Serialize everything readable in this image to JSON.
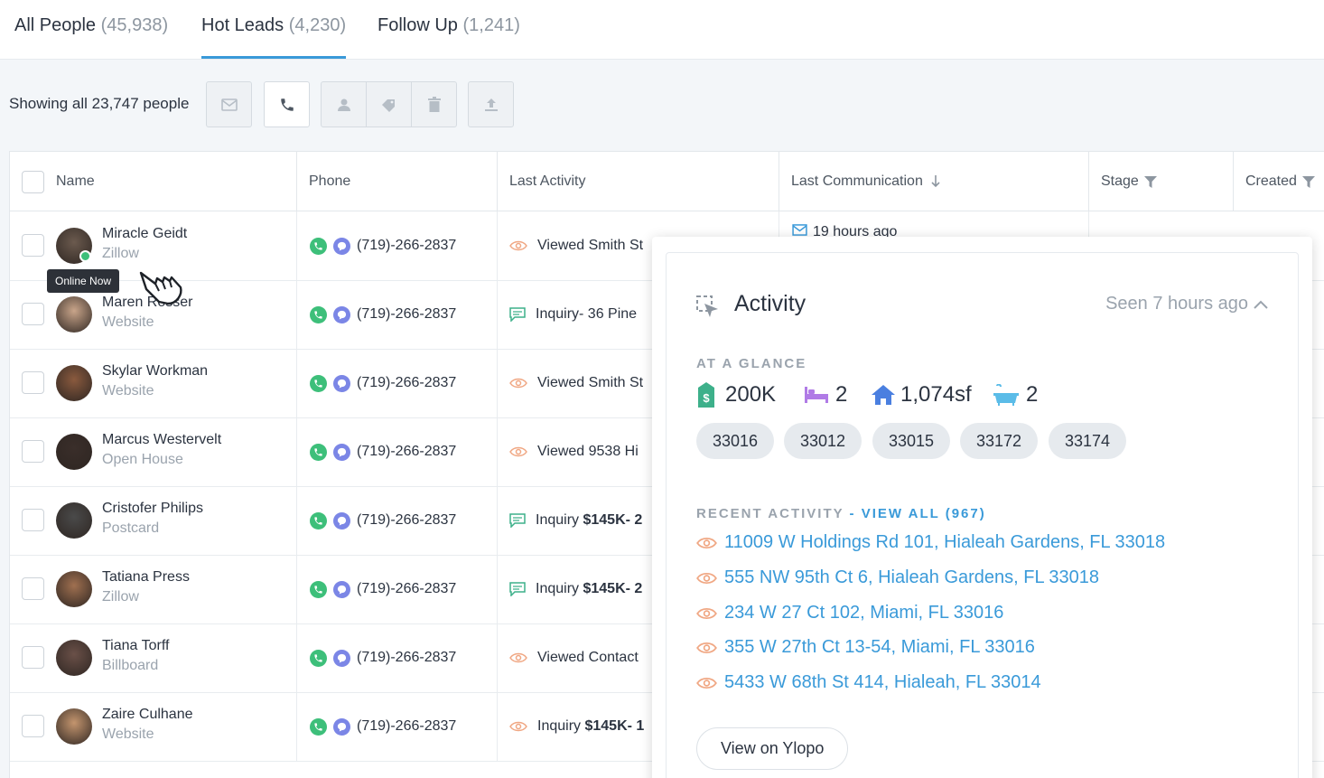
{
  "tabs": [
    {
      "label": "All People",
      "count": "(45,938)"
    },
    {
      "label": "Hot Leads",
      "count": "(4,230)"
    },
    {
      "label": "Follow Up",
      "count": "(1,241)"
    }
  ],
  "toolbar": {
    "showing_label": "Showing all 23,747 people"
  },
  "table": {
    "headers": {
      "name": "Name",
      "phone": "Phone",
      "last_activity": "Last Activity",
      "last_communication": "Last Communication",
      "stage": "Stage",
      "created": "Created"
    },
    "rows": [
      {
        "name": "Miracle Geidt",
        "source": "Zillow",
        "phone": "(719)-266-2837",
        "activity": "Viewed Smith St",
        "activity_icon": "eye-icon",
        "comm": "19 hours ago"
      },
      {
        "name": "Maren Rosser",
        "source": "Website",
        "phone": "(719)-266-2837",
        "activity": "Inquiry- 36 Pine",
        "activity_icon": "chat-icon"
      },
      {
        "name": "Skylar Workman",
        "source": "Website",
        "phone": "(719)-266-2837",
        "activity": "Viewed Smith St",
        "activity_icon": "eye-icon"
      },
      {
        "name": "Marcus Westervelt",
        "source": "Open House",
        "phone": "(719)-266-2837",
        "activity": "Viewed 9538 Hi",
        "activity_icon": "eye-icon"
      },
      {
        "name": "Cristofer Philips",
        "source": "Postcard",
        "phone": "(719)-266-2837",
        "activity_prefix": "Inquiry ",
        "activity_bold": "$145K- 2",
        "activity_icon": "chat-icon"
      },
      {
        "name": "Tatiana Press",
        "source": "Zillow",
        "phone": "(719)-266-2837",
        "activity_prefix": "Inquiry ",
        "activity_bold": "$145K- 2",
        "activity_icon": "chat-icon"
      },
      {
        "name": "Tiana Torff",
        "source": "Billboard",
        "phone": "(719)-266-2837",
        "activity": "Viewed Contact",
        "activity_icon": "eye-icon"
      },
      {
        "name": "Zaire Culhane",
        "source": "Website",
        "phone": "(719)-266-2837",
        "activity_prefix": "Inquiry ",
        "activity_bold": "$145K- 1",
        "activity_icon": "eye-icon"
      }
    ]
  },
  "tooltip": {
    "text": "Online Now"
  },
  "popup": {
    "title": "Activity",
    "seen": "Seen 7 hours ago",
    "glance_label": "AT A GLANCE",
    "glance": {
      "price": "200K",
      "beds": "2",
      "sqft": "1,074sf",
      "baths": "2"
    },
    "zips": [
      "33016",
      "33012",
      "33015",
      "33172",
      "33174"
    ],
    "recent_label": "RECENT ACTIVITY",
    "recent_link": "- VIEW ALL (967)",
    "recent": [
      "11009 W Holdings Rd 101, Hialeah Gardens, FL 33018",
      "555 NW 95th Ct 6, Hialeah Gardens, FL 33018",
      "234 W 27 Ct 102, Miami, FL 33016",
      "355 W 27th Ct 13-54, Miami, FL 33016",
      "5433 W 68th St 414, Hialeah, FL 33014"
    ],
    "view_button": "View on Ylopo"
  },
  "colors": {
    "accent": "#3a9ad9",
    "green": "#3dbf7a",
    "purple": "#7b86e6",
    "orange": "#f0a783",
    "teal": "#3db08a"
  }
}
